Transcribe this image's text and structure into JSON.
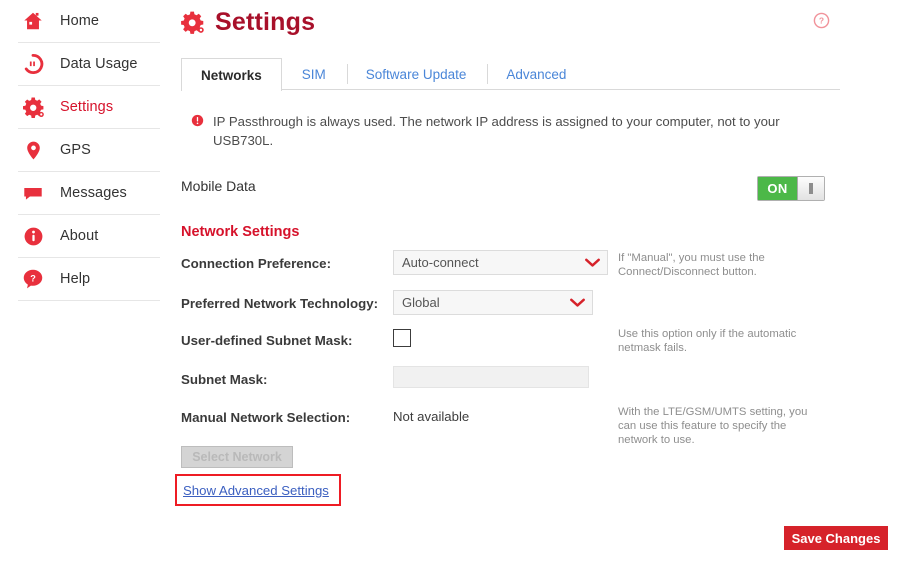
{
  "colors": {
    "brand_red": "#d6122b",
    "title_red": "#a8102a",
    "link_blue": "#3b5fc0",
    "tab_blue": "#4a86d8",
    "toggle_green": "#4cb848",
    "annotation_red": "#ee1c24"
  },
  "sidebar": {
    "items": [
      {
        "label": "Home",
        "icon": "home-icon",
        "active": false
      },
      {
        "label": "Data Usage",
        "icon": "data-usage-icon",
        "active": false
      },
      {
        "label": "Settings",
        "icon": "gear-icon",
        "active": true
      },
      {
        "label": "GPS",
        "icon": "location-pin-icon",
        "active": false
      },
      {
        "label": "Messages",
        "icon": "message-icon",
        "active": false
      },
      {
        "label": "About",
        "icon": "info-icon",
        "active": false
      },
      {
        "label": "Help",
        "icon": "question-icon",
        "active": false
      }
    ]
  },
  "header": {
    "title": "Settings",
    "icon": "gear-icon",
    "help_icon": "help-circle-icon"
  },
  "tabs": [
    {
      "label": "Networks",
      "active": true
    },
    {
      "label": "SIM",
      "active": false
    },
    {
      "label": "Software Update",
      "active": false
    },
    {
      "label": "Advanced",
      "active": false
    }
  ],
  "notice": {
    "icon": "alert-circle-icon",
    "text": "IP Passthrough is always used. The network IP address is assigned to your computer, not to your USB730L."
  },
  "mobile_data": {
    "label": "Mobile Data",
    "toggle_state": "ON"
  },
  "network_settings": {
    "section_title": "Network Settings",
    "rows": [
      {
        "label": "Connection Preference:",
        "control": "select",
        "value": "Auto-connect",
        "hint": "If \"Manual\", you must use the Connect/Disconnect button."
      },
      {
        "label": "Preferred Network Technology:",
        "control": "select",
        "value": "Global",
        "hint": ""
      },
      {
        "label": "User-defined Subnet Mask:",
        "control": "checkbox",
        "value": "",
        "checked": false,
        "hint": "Use this option only if the automatic netmask fails."
      },
      {
        "label": "Subnet Mask:",
        "control": "text",
        "value": "",
        "placeholder": "",
        "hint": ""
      },
      {
        "label": "Manual Network Selection:",
        "control": "static",
        "value": "Not available",
        "hint": "With the LTE/GSM/UMTS setting, you can use this feature to specify the network to use."
      }
    ]
  },
  "buttons": {
    "select_network": "Select Network",
    "show_advanced": "Show Advanced Settings",
    "save_changes": "Save Changes"
  }
}
